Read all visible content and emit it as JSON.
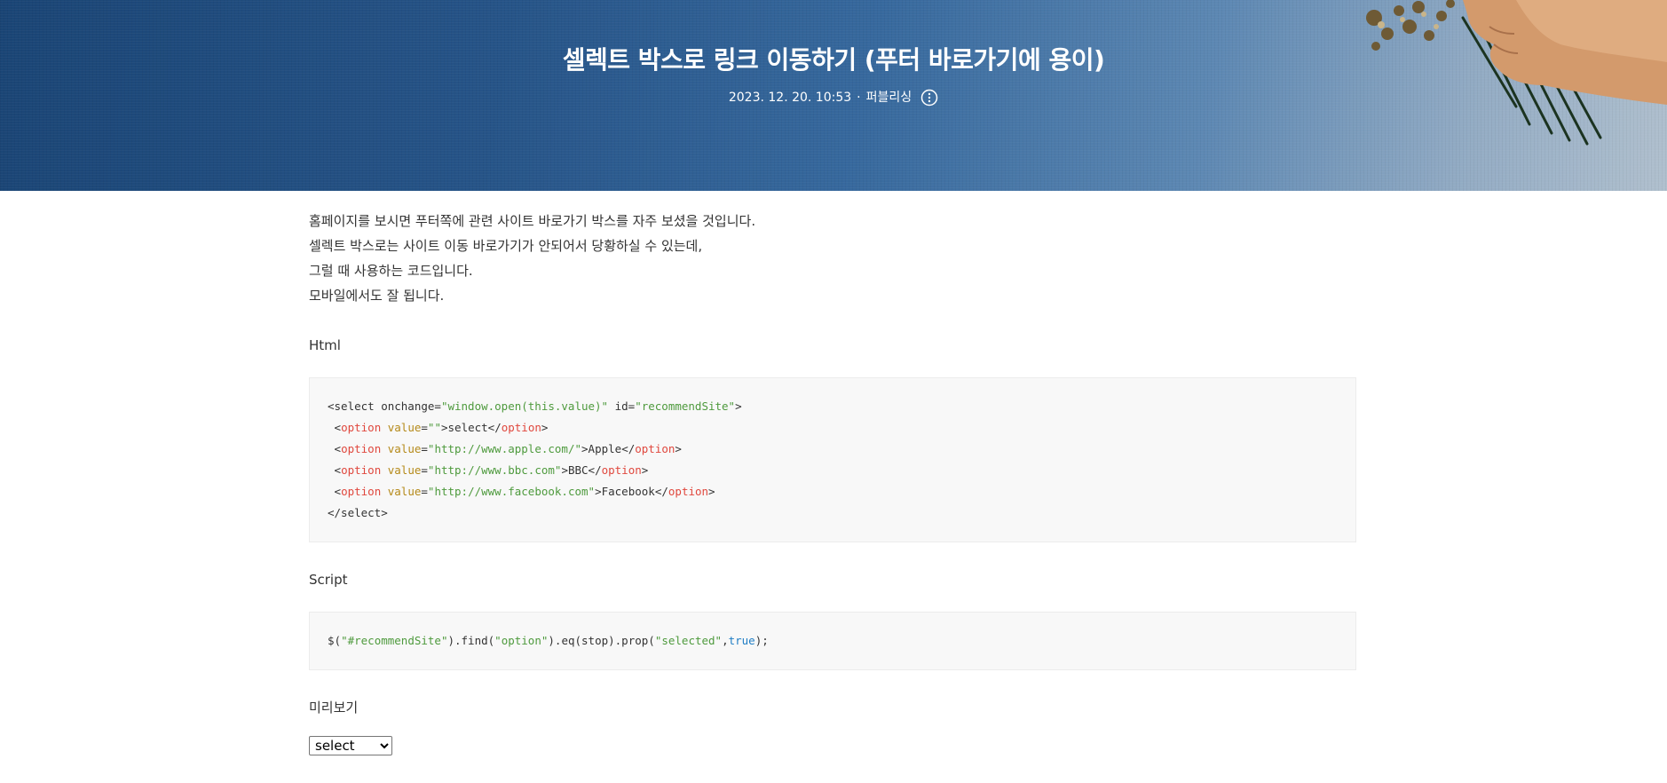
{
  "header": {
    "title": "셀렉트 박스로 링크 이동하기 (푸터 바로가기에 용이)",
    "date": "2023. 12. 20. 10:53",
    "separator": "·",
    "status": "퍼블리싱",
    "more_icon": "more-vertical-circle-icon"
  },
  "body": {
    "paragraphs": [
      "홈페이지를 보시면 푸터쪽에 관련 사이트 바로가기 박스를 자주 보셨을 것입니다.",
      "셀렉트 박스로는 사이트 이동 바로가기가 안되어서 당황하실 수 있는데,",
      "그럴 때 사용하는 코드입니다.",
      "모바일에서도 잘 됩니다."
    ],
    "html_label": "Html",
    "script_label": "Script",
    "preview_label": "미리보기"
  },
  "code_html": {
    "line1": {
      "open": "<select onchange=",
      "attr_val1": "\"window.open(this.value)\"",
      "mid": " id=",
      "attr_val2": "\"recommendSite\"",
      "close": ">"
    },
    "lines": [
      {
        "lt": " <",
        "tag": "option",
        "sp": " ",
        "attr": "value",
        "eq": "=",
        "val": "\"\"",
        "gt": ">",
        "text": "select",
        "lt2": "</",
        "tag2": "option",
        "gt2": ">"
      },
      {
        "lt": " <",
        "tag": "option",
        "sp": " ",
        "attr": "value",
        "eq": "=",
        "val": "\"http://www.apple.com/\"",
        "gt": ">",
        "text": "Apple",
        "lt2": "</",
        "tag2": "option",
        "gt2": ">"
      },
      {
        "lt": " <",
        "tag": "option",
        "sp": " ",
        "attr": "value",
        "eq": "=",
        "val": "\"http://www.bbc.com\"",
        "gt": ">",
        "text": "BBC",
        "lt2": "</",
        "tag2": "option",
        "gt2": ">"
      },
      {
        "lt": " <",
        "tag": "option",
        "sp": " ",
        "attr": "value",
        "eq": "=",
        "val": "\"http://www.facebook.com\"",
        "gt": ">",
        "text": "Facebook",
        "lt2": "</",
        "tag2": "option",
        "gt2": ">"
      }
    ],
    "last": "</select>"
  },
  "code_script": {
    "p1": "$(",
    "s1": "\"#recommendSite\"",
    "p2": ").find(",
    "s2": "\"option\"",
    "p3": ").eq(stop).prop(",
    "s3": "\"selected\"",
    "p4": ",",
    "kw": "true",
    "p5": ");"
  },
  "preview": {
    "selected_option": "select"
  },
  "colors": {
    "string": "#4e9a3d",
    "tag": "#e0483e",
    "attribute": "#b58a1a",
    "keyword": "#1f7dc4",
    "code_bg": "#f8f8f8"
  }
}
